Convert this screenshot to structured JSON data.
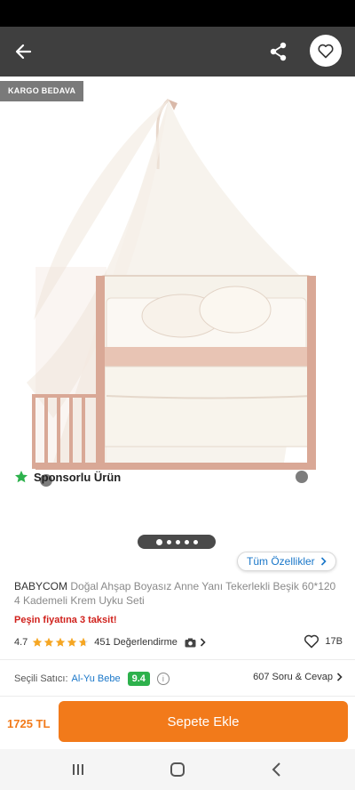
{
  "badge": "KARGO BEDAVA",
  "sponsored": "Sponsorlu Ürün",
  "gallery": {
    "total": 5,
    "current": 1
  },
  "features_label": "Tüm Özellikler",
  "product": {
    "brand": "BABYCOM",
    "name": "Doğal Ahşap Boyasız Anne Yanı Tekerlekli Beşik 60*120 4 Kademeli Krem Uyku Seti"
  },
  "installment": "Peşin fiyatına 3 taksit!",
  "rating": {
    "value": "4.7",
    "stars": 4.7,
    "reviews": "451 Değerlendirme",
    "likes": "17B"
  },
  "seller": {
    "label": "Seçili Satıcı:",
    "name": "Al-Yu Bebe",
    "score": "9.4"
  },
  "qa": "607 Soru & Cevap",
  "price": "1725 TL",
  "cart_button": "Sepete Ekle",
  "colors": {
    "accent": "#f27a1a",
    "link": "#1a77c9",
    "score": "#2db14c",
    "installment": "#d0211c",
    "star": "#f5a623"
  },
  "icons": [
    "back-arrow-icon",
    "share-icon",
    "heart-icon",
    "star-icon",
    "camera-icon",
    "chevron-right-icon",
    "info-icon",
    "recents-icon",
    "home-icon",
    "back-icon"
  ]
}
